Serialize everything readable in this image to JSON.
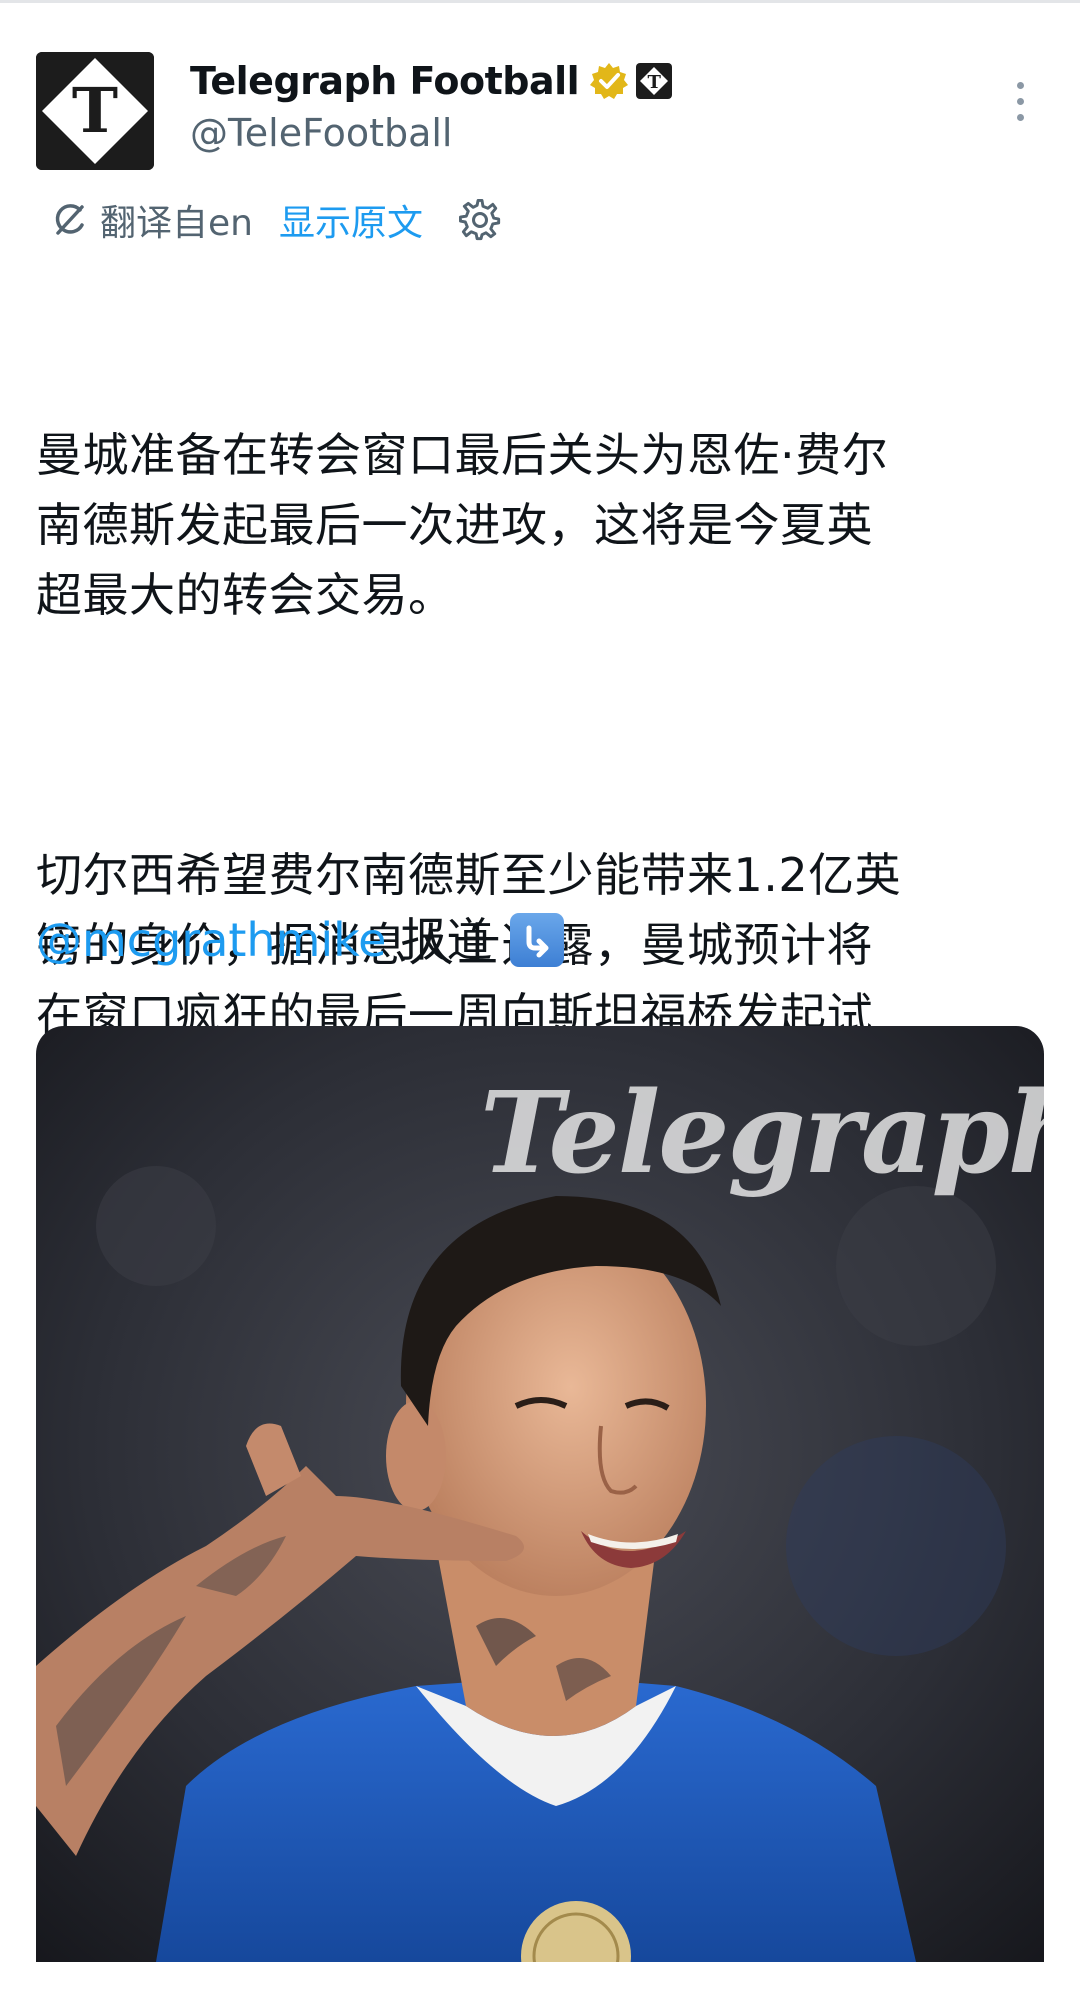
{
  "author": {
    "display_name": "Telegraph Football",
    "handle": "@TeleFootball",
    "avatar_icon": "telegraph-t-logo",
    "verified_badge_color": "#e2b719"
  },
  "translation": {
    "label": "翻译自en",
    "show_original": "显示原文"
  },
  "tweet": {
    "paragraph_1": "曼城准备在转会窗口最后关头为恩佐·费尔\n南德斯发起最后一次进攻，这将是今夏英\n超最大的转会交易。",
    "paragraph_2": "切尔西希望费尔南德斯至少能带来1.2亿英\n镑的身价，据消息人士透露，曼城预计将\n在窗口疯狂的最后一周向斯坦福桥发起试\n探，考验他们的决心",
    "mention": "@mcgrathmike",
    "report_label": "报道"
  },
  "media": {
    "watermark": "Telegraph",
    "jersey_color": "#1f5fc4"
  },
  "colors": {
    "link": "#1d9bf0",
    "secondary_text": "#536471",
    "primary_text": "#0f1419"
  }
}
